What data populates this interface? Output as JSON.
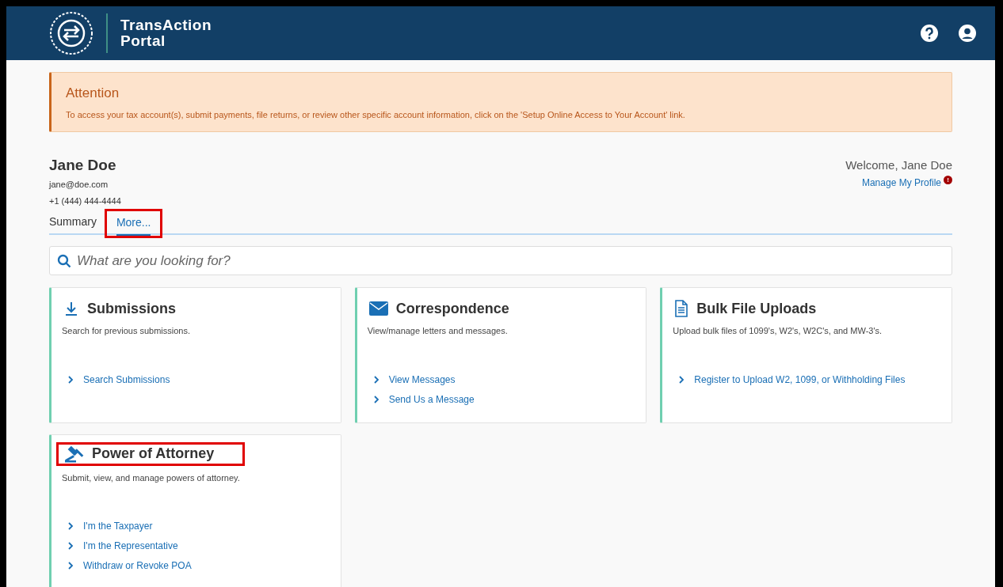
{
  "header": {
    "title_line_1": "TransAction",
    "title_line_2": "Portal"
  },
  "alert": {
    "title": "Attention",
    "message": "To access your tax account(s), submit payments, file returns, or review other specific account information, click on the 'Setup Online Access to Your Account' link."
  },
  "profile": {
    "name": "Jane Doe",
    "email": "jane@doe.com",
    "phone": "+1 (444) 444-4444",
    "welcome": "Welcome, Jane Doe",
    "manage_link": "Manage My Profile",
    "notification_badge": "!"
  },
  "tabs": [
    {
      "label": "Summary",
      "selected": false,
      "highlighted": false
    },
    {
      "label": "More...",
      "selected": true,
      "highlighted": true
    }
  ],
  "search": {
    "placeholder": "What are you looking for?"
  },
  "cards": [
    {
      "kind": "download",
      "title": "Submissions",
      "description": "Search for previous submissions.",
      "highlighted": false,
      "links": [
        "Search Submissions"
      ]
    },
    {
      "kind": "mail",
      "title": "Correspondence",
      "description": "View/manage letters and messages.",
      "highlighted": false,
      "links": [
        "View Messages",
        "Send Us a Message"
      ]
    },
    {
      "kind": "document",
      "title": "Bulk File Uploads",
      "description": "Upload bulk files of 1099's, W2's, W2C's, and MW-3's.",
      "highlighted": false,
      "links": [
        "Register to Upload W2, 1099, or Withholding Files"
      ]
    },
    {
      "kind": "gavel",
      "title": "Power of Attorney",
      "description": "Submit, view, and manage powers of attorney.",
      "highlighted": true,
      "links": [
        "I'm the Taxpayer",
        "I'm the Representative",
        "Withdraw or Revoke POA"
      ]
    }
  ]
}
